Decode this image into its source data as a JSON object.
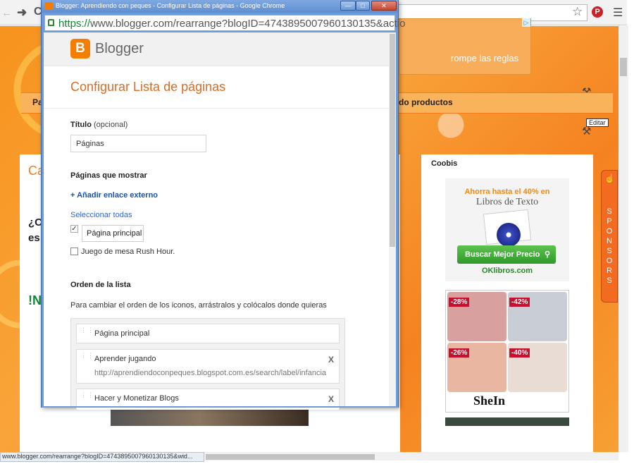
{
  "popup": {
    "window_title": "Blogger: Aprendiendo con peques - Configurar Lista de páginas - Google Chrome",
    "url_scheme": "https://",
    "url_rest": "www.blogger.com/rearrange?blogID=4743895007960130135&actio",
    "brand": "Blogger",
    "heading": "Configurar Lista de páginas",
    "title_label": "Título",
    "title_optional": "(opcional)",
    "title_value": "Páginas",
    "pages_label": "Páginas que mostrar",
    "add_external_link": "+ Añadir enlace externo",
    "select_all": "Seleccionar todas",
    "pages": [
      {
        "label": "Página principal",
        "checked": true
      },
      {
        "label": "Juego de mesa Rush Hour.",
        "checked": false
      }
    ],
    "order_label": "Orden de la lista",
    "order_desc": "Para cambiar el orden de los iconos, arrástralos y colócalos donde quieras",
    "list_items": [
      {
        "title": "Página principal",
        "url": "",
        "removable": false
      },
      {
        "title": "Aprender jugando",
        "url": "http://aprendiendoconpeques.blogspot.com.es/search/label/infancia",
        "removable": true
      },
      {
        "title": "Hacer y Monetizar Blogs",
        "url": "",
        "removable": true
      }
    ],
    "remove_glyph": "X"
  },
  "background": {
    "ad_text": "rompe las reglas",
    "nav_left": "Pa",
    "nav_right": "do productos",
    "edit_tooltip": "Editar",
    "main_letter": "Ca",
    "main_question": "¿C\nes",
    "main_green": "!N",
    "sidebar_title": "Coobis",
    "books_ad_top": "Ahorra hasta el 40% en",
    "books_ad_title": "Libros de Texto",
    "books_ad_button": "Buscar Mejor Precio",
    "books_ad_logo": "OKlibros.com",
    "shein_tags": [
      "-28%",
      "-42%",
      "-26%",
      "-40%"
    ],
    "shein_logo": "SheIn",
    "sponsors": "S\nP\nO\nN\nS\nO\nR\nS",
    "status_url": "www.blogger.com/rearrange?blogID=4743895007960130135&wid..."
  }
}
